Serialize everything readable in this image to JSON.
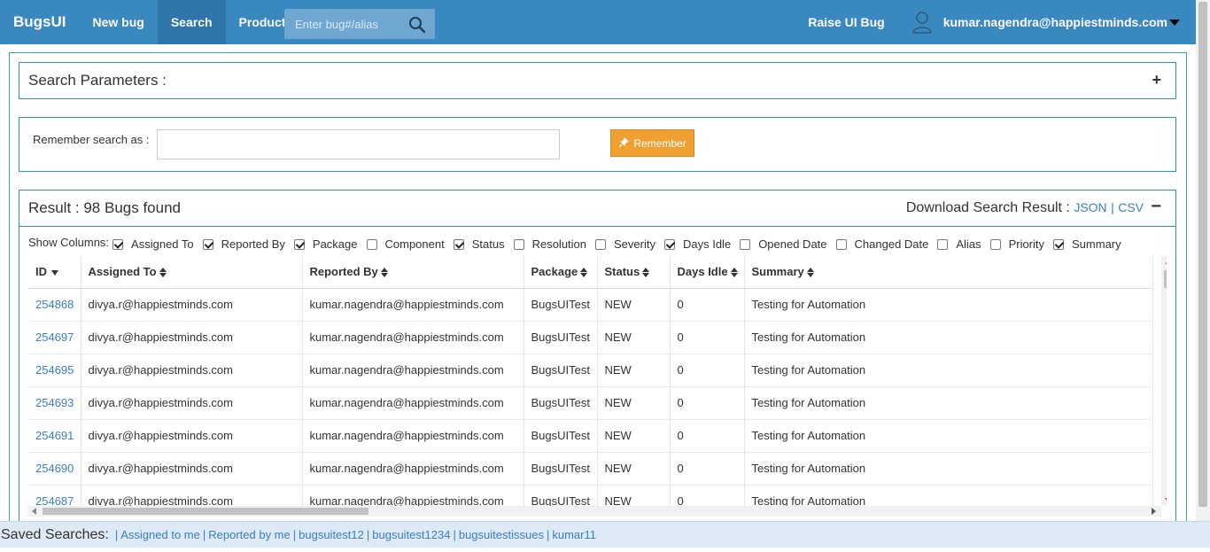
{
  "nav": {
    "brand": "BugsUI",
    "links": [
      {
        "label": "New bug",
        "active": false
      },
      {
        "label": "Search",
        "active": true
      },
      {
        "label": "Product",
        "active": false
      }
    ],
    "search_placeholder": "Enter bug#/alias",
    "raise_bug": "Raise UI Bug",
    "user_email": "kumar.nagendra@happiestminds.com",
    "bg_color": "#3a88c0"
  },
  "params": {
    "title": "Search Parameters :",
    "toggle": "+"
  },
  "remember": {
    "label": "Remember search as :",
    "value": "",
    "button": "Remember"
  },
  "result": {
    "title": "Result : 98 Bugs found",
    "download_label": "Download Search Result :",
    "json": "JSON",
    "csv": "CSV",
    "toggle": "−"
  },
  "show_columns": {
    "label": "Show Columns:",
    "options": [
      {
        "label": "Assigned To",
        "checked": true
      },
      {
        "label": "Reported By",
        "checked": true
      },
      {
        "label": "Package",
        "checked": true
      },
      {
        "label": "Component",
        "checked": false
      },
      {
        "label": "Status",
        "checked": true
      },
      {
        "label": "Resolution",
        "checked": false
      },
      {
        "label": "Severity",
        "checked": false
      },
      {
        "label": "Days Idle",
        "checked": true
      },
      {
        "label": "Opened Date",
        "checked": false
      },
      {
        "label": "Changed Date",
        "checked": false
      },
      {
        "label": "Alias",
        "checked": false
      },
      {
        "label": "Priority",
        "checked": false
      },
      {
        "label": "Summary",
        "checked": true
      }
    ]
  },
  "table": {
    "headers": [
      "ID",
      "Assigned To",
      "Reported By",
      "Package",
      "Status",
      "Days Idle",
      "Summary"
    ],
    "rows": [
      [
        "254868",
        "divya.r@happiestminds.com",
        "kumar.nagendra@happiestminds.com",
        "BugsUITest",
        "NEW",
        "0",
        "Testing for Automation"
      ],
      [
        "254697",
        "divya.r@happiestminds.com",
        "kumar.nagendra@happiestminds.com",
        "BugsUITest",
        "NEW",
        "0",
        "Testing for Automation"
      ],
      [
        "254695",
        "divya.r@happiestminds.com",
        "kumar.nagendra@happiestminds.com",
        "BugsUITest",
        "NEW",
        "0",
        "Testing for Automation"
      ],
      [
        "254693",
        "divya.r@happiestminds.com",
        "kumar.nagendra@happiestminds.com",
        "BugsUITest",
        "NEW",
        "0",
        "Testing for Automation"
      ],
      [
        "254691",
        "divya.r@happiestminds.com",
        "kumar.nagendra@happiestminds.com",
        "BugsUITest",
        "NEW",
        "0",
        "Testing for Automation"
      ],
      [
        "254690",
        "divya.r@happiestminds.com",
        "kumar.nagendra@happiestminds.com",
        "BugsUITest",
        "NEW",
        "0",
        "Testing for Automation"
      ],
      [
        "254687",
        "divya.r@happiestminds.com",
        "kumar.nagendra@happiestminds.com",
        "BugsUITest",
        "NEW",
        "0",
        "Testing for Automation"
      ]
    ]
  },
  "footer": {
    "label": "Saved Searches:",
    "links": [
      "Assigned to me",
      "Reported by me",
      "bugsuitest12",
      "bugsuitest1234",
      "bugsuitestissues",
      "kumar11"
    ]
  }
}
